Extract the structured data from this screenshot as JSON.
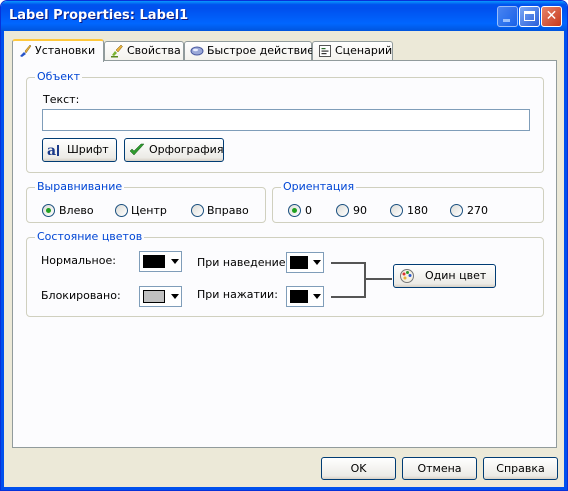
{
  "window": {
    "title": "Label Properties: Label1"
  },
  "tabs": [
    {
      "label": "Установки",
      "icon": "brush-icon",
      "active": true
    },
    {
      "label": "Свойства",
      "icon": "properties-icon",
      "active": false
    },
    {
      "label": "Быстрое действие",
      "icon": "quick-action-icon",
      "active": false
    },
    {
      "label": "Сценарий",
      "icon": "script-icon",
      "active": false
    }
  ],
  "object_group": {
    "legend": "Объект",
    "text_label": "Текст:",
    "text_value": "",
    "font_button": "Шрифт",
    "spelling_button": "Орфография"
  },
  "align_group": {
    "legend": "Выравнивание",
    "options": [
      {
        "label": "Влево",
        "selected": true
      },
      {
        "label": "Центр",
        "selected": false
      },
      {
        "label": "Вправо",
        "selected": false
      }
    ]
  },
  "orient_group": {
    "legend": "Ориентация",
    "options": [
      {
        "label": "0",
        "selected": true
      },
      {
        "label": "90",
        "selected": false
      },
      {
        "label": "180",
        "selected": false
      },
      {
        "label": "270",
        "selected": false
      }
    ]
  },
  "colors_group": {
    "legend": "Состояние цветов",
    "normal_label": "Нормальное:",
    "normal_color": "#000000",
    "disabled_label": "Блокировано:",
    "disabled_color": "#c0c0c0",
    "hover_label": "При наведение:",
    "hover_color": "#000000",
    "pressed_label": "При нажатии:",
    "pressed_color": "#000000",
    "single_color_button": "Один цвет"
  },
  "footer": {
    "ok": "OK",
    "cancel": "Отмена",
    "help": "Справка"
  }
}
